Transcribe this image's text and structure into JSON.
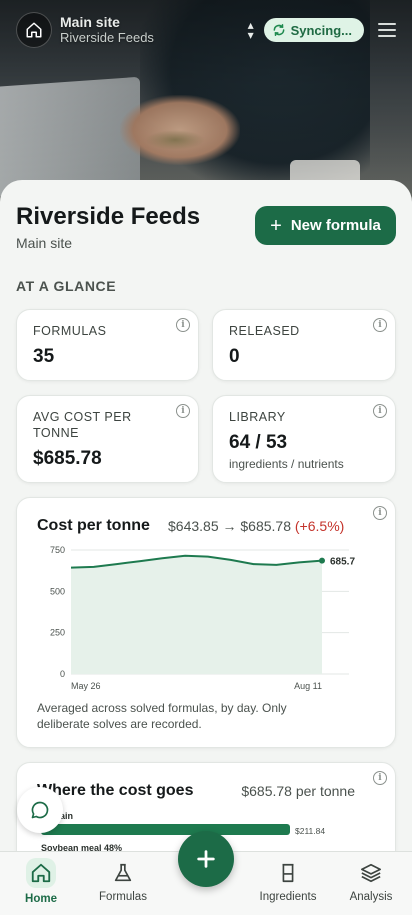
{
  "header": {
    "site_name": "Main site",
    "org_name": "Riverside Feeds",
    "sync_status": "Syncing..."
  },
  "page": {
    "title": "Riverside Feeds",
    "subtitle": "Main site",
    "new_formula_label": "New formula",
    "section_title": "AT A GLANCE"
  },
  "stats": {
    "formulas": {
      "label": "FORMULAS",
      "value": "35"
    },
    "released": {
      "label": "RELEASED",
      "value": "0"
    },
    "avg_cost": {
      "label_line1": "AVG COST PER",
      "label_line2": "TONNE",
      "value": "$685.78"
    },
    "library": {
      "label": "LIBRARY",
      "value": "64 / 53",
      "sub": "ingredients / nutrients"
    }
  },
  "cost_chart": {
    "title": "Cost per tonne",
    "range_text": "$643.85 → $685.78",
    "change_text": "(+6.5%)",
    "note": "Averaged across solved formulas, by day. Only deliberate solves are recorded.",
    "end_label": "685.7"
  },
  "chart_data": {
    "type": "area",
    "x": [
      "May 26",
      "",
      "",
      "",
      "",
      "",
      "",
      "",
      "",
      "",
      "",
      "Aug 11"
    ],
    "y": [
      643.85,
      648,
      665,
      682,
      700,
      715,
      710,
      690,
      665,
      660,
      675,
      685.78
    ],
    "xtick_labels": [
      "May 26",
      "Aug 11"
    ],
    "ytick_labels": [
      "0",
      "250",
      "500",
      "750"
    ],
    "ylim": [
      0,
      750
    ],
    "grid": true,
    "color": "#1e7a4f"
  },
  "where_cost": {
    "title": "Where the cost goes",
    "amount": "$685.78 per tonne",
    "items": [
      {
        "label": "... grain",
        "value": "$211.84",
        "fraction": 0.31
      },
      {
        "label": "Soybean meal 48%",
        "value": "",
        "fraction": 0.0
      }
    ]
  },
  "nav": {
    "home": "Home",
    "formulas": "Formulas",
    "ingredients": "Ingredients",
    "analysis": "Analysis"
  },
  "colors": {
    "brand": "#1c6b47",
    "negative": "#c4332b"
  }
}
